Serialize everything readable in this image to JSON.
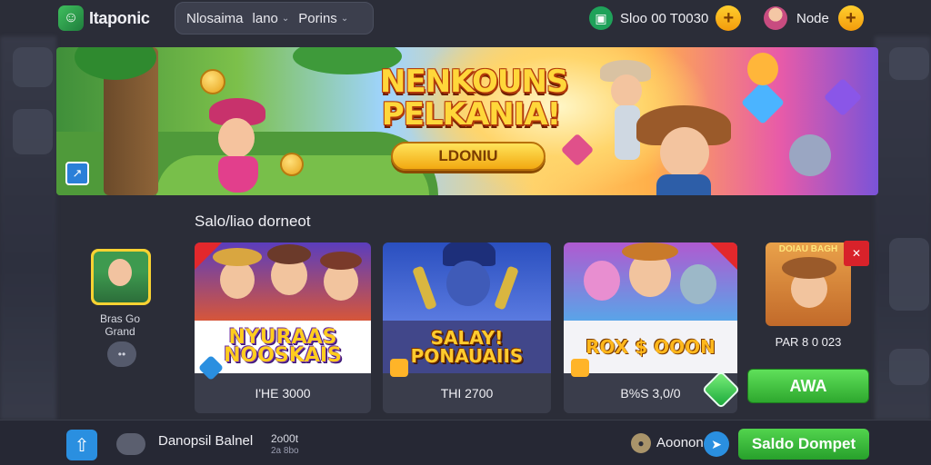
{
  "app": {
    "name": "Itaponic"
  },
  "nav": {
    "items": [
      {
        "label": "Nlosaima",
        "has_menu": false
      },
      {
        "label": "lano",
        "has_menu": true
      },
      {
        "label": "Porins",
        "has_menu": true
      }
    ]
  },
  "wallet": {
    "amount": "Sloo 00 T0030"
  },
  "user": {
    "name": "Node"
  },
  "banner": {
    "title_line1": "NENKOUNS",
    "title_line2": "PELKANIA!",
    "button_label": "LDONIU"
  },
  "section": {
    "title": "Salo/liao dorneot"
  },
  "side_item": {
    "label": "Bras Go Grand",
    "dot_label": "••"
  },
  "cards": [
    {
      "art_text": "",
      "banner_text": "NYURAAS NOOSKAIS",
      "price": "I'HE 3000"
    },
    {
      "art_text": "",
      "banner_text": "SALAY! PONAUAIIS",
      "price": "THI 2700"
    },
    {
      "art_text": "",
      "banner_text": "ROX $ OOON",
      "price": "B%S 3,0/0"
    }
  ],
  "card4": {
    "label_top": "DOIAU BAGH",
    "price": "PAR 8 0 023"
  },
  "green_button": {
    "label": "AWA"
  },
  "bottom": {
    "title": "Danopsil Balnel",
    "sub1": "2o00t",
    "sub2": "2a 8bo",
    "link": "Aoonon",
    "button_label": "Saldo Dompet"
  },
  "icons": {
    "logo": "app-logo-icon",
    "wallet": "wallet-icon",
    "plus": "plus-icon",
    "avatar": "avatar-icon",
    "up": "arrow-up-icon",
    "cloud": "cloud-icon",
    "info": "info-icon",
    "send": "send-icon"
  },
  "colors": {
    "accent_green": "#2ea82e",
    "accent_gold": "#f39b0c",
    "accent_blue": "#2a8fe0",
    "background": "#2b2d38"
  }
}
